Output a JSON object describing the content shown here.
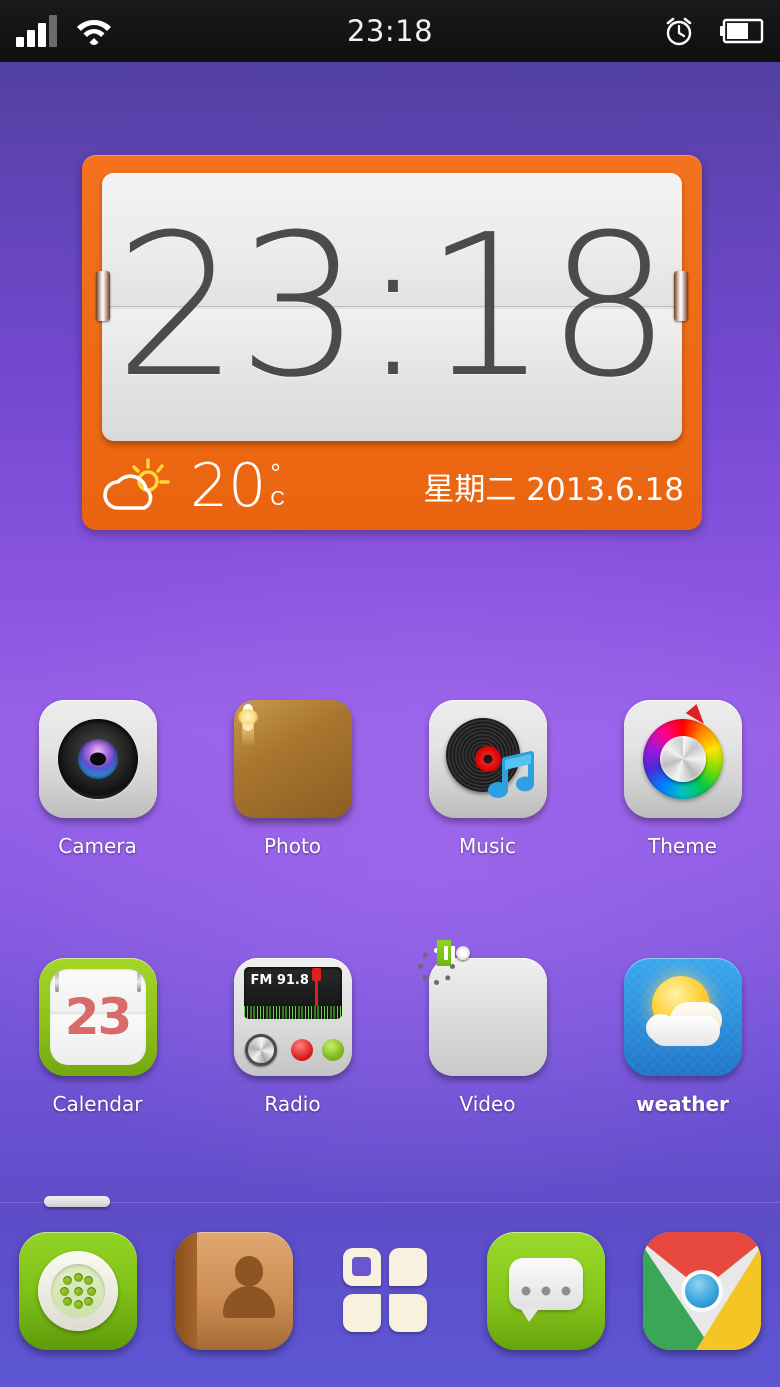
{
  "status_bar": {
    "time": "23:18",
    "icons": {
      "signal": "signal-bars-icon",
      "wifi": "wifi-icon",
      "alarm": "alarm-clock-icon",
      "battery": "battery-icon"
    },
    "signal_bars_active": 3,
    "signal_bars_total": 4,
    "battery_level_percent": 60
  },
  "clock_widget": {
    "time": "23:18",
    "temperature": "20",
    "degree_symbol": "°",
    "unit": "C",
    "weather_icon": "sun-behind-cloud-icon",
    "date": "星期二 2013.6.18",
    "frame_color": "#ef6c16"
  },
  "home_grid": {
    "rows": [
      {
        "apps": [
          {
            "label": "Camera",
            "icon": "camera-icon"
          },
          {
            "label": "Photo",
            "icon": "photo-gallery-icon"
          },
          {
            "label": "Music",
            "icon": "music-vinyl-note-icon"
          },
          {
            "label": "Theme",
            "icon": "theme-color-wheel-icon"
          }
        ]
      },
      {
        "apps": [
          {
            "label": "Calendar",
            "icon": "calendar-icon",
            "day_number": "23"
          },
          {
            "label": "Radio",
            "icon": "radio-icon",
            "station": "FM 91.8"
          },
          {
            "label": "Video",
            "icon": "video-player-icon"
          },
          {
            "label": "weather",
            "icon": "weather-sun-cloud-icon",
            "bold": true
          }
        ]
      }
    ]
  },
  "page_indicator": {
    "name": "page-indicator",
    "pages": 1,
    "current": 1
  },
  "dock": {
    "apps": [
      {
        "name": "phone-dialer",
        "icon": "phone-dialer-icon"
      },
      {
        "name": "contacts",
        "icon": "contacts-person-icon"
      },
      {
        "name": "app-drawer",
        "icon": "app-drawer-grid-icon"
      },
      {
        "name": "messaging",
        "icon": "message-bubble-icon"
      },
      {
        "name": "browser",
        "icon": "chrome-browser-icon"
      }
    ]
  },
  "colors": {
    "wallpaper_top": "#4a3d96",
    "wallpaper_mid": "#9761e8",
    "wallpaper_bottom": "#5d57d4",
    "widget_orange": "#ef6c16",
    "status_bar": "#141414"
  }
}
